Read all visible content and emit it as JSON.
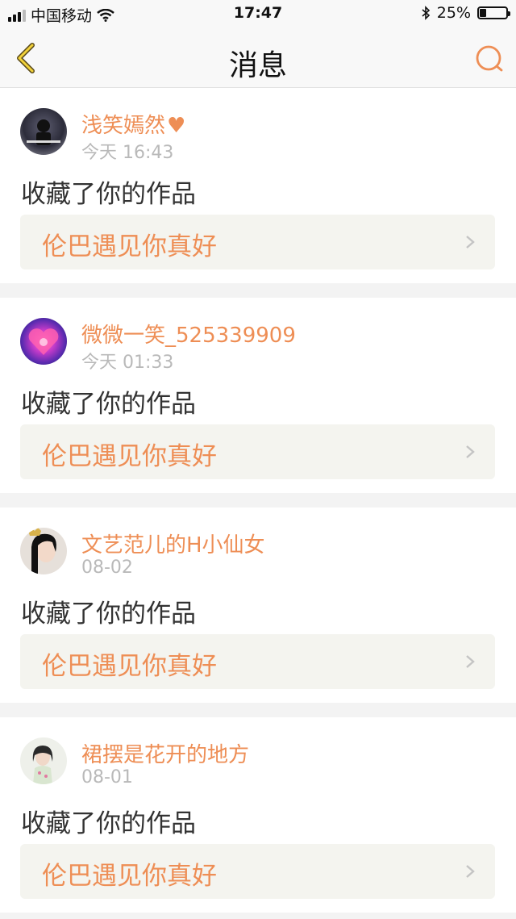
{
  "status_bar": {
    "carrier": "中国移动",
    "time": "17:47",
    "battery_percent": "25%",
    "battery_level": 0.25
  },
  "nav": {
    "title": "消息",
    "back_icon": "chevron-left-icon",
    "search_icon": "search-icon",
    "accent_color": "#ee8e55"
  },
  "messages": [
    {
      "username": "浅笑嫣然",
      "has_heart": true,
      "time": "今天 16:43",
      "action": "收藏了你的作品",
      "work_title": "伦巴遇见你真好"
    },
    {
      "username": "微微一笑_525339909",
      "has_heart": false,
      "time": "今天 01:33",
      "action": "收藏了你的作品",
      "work_title": "伦巴遇见你真好"
    },
    {
      "username": "文艺范儿的H小仙女",
      "has_heart": false,
      "time": "08-02",
      "action": "收藏了你的作品",
      "work_title": "伦巴遇见你真好"
    },
    {
      "username": "裙摆是花开的地方",
      "has_heart": false,
      "time": "08-01",
      "action": "收藏了你的作品",
      "work_title": "伦巴遇见你真好"
    }
  ]
}
